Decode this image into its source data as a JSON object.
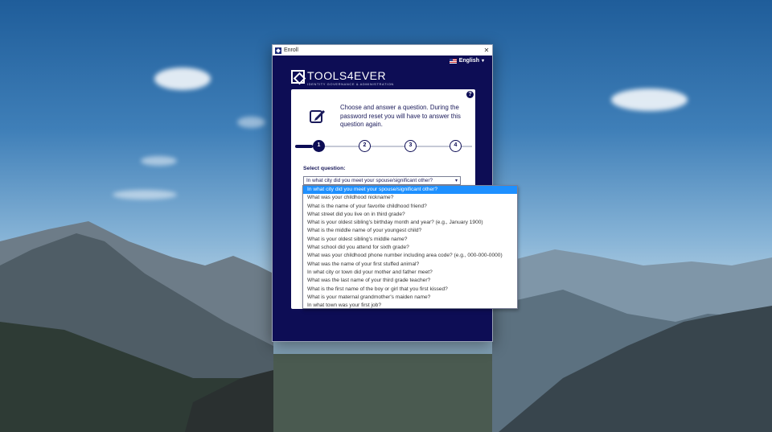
{
  "window": {
    "title": "Enroll",
    "close_glyph": "✕",
    "language": "English",
    "language_caret": "▾",
    "logo_text": "TOOLS4EVER",
    "logo_subtitle": "IDENTITY GOVERNANCE & ADMINISTRATION"
  },
  "card": {
    "help_glyph": "?",
    "intro": "Choose and answer a question. During the password reset you will have to answer this question again.",
    "steps": [
      "1",
      "2",
      "3",
      "4"
    ],
    "active_step": 1,
    "select_label": "Select question:",
    "selected_value": "In what city did you meet your spouse/significant other?",
    "select_arrow": "▾"
  },
  "dropdown": {
    "options": [
      "In what city did you meet your spouse/significant other?",
      "What was your childhood nickname?",
      "What is the name of your favorite childhood friend?",
      "What street did you live on in third grade?",
      "What is your oldest sibling's birthday month and year? (e.g., January 1900)",
      "What is the middle name of your youngest child?",
      "What is your oldest sibling's middle name?",
      "What school did you attend for sixth grade?",
      "What was your childhood phone number including area code? (e.g., 000-000-0000)",
      "What was the name of your first stuffed animal?",
      "In what city or town did your mother and father meet?",
      "What was the last name of your third grade teacher?",
      "What is the first name of the boy or girl that you first kissed?",
      "What is your maternal grandmother's maiden name?",
      "In what town was your first job?"
    ],
    "selected_index": 0
  },
  "colors": {
    "window_bg": "#0d0d55",
    "selection": "#1e90ff"
  },
  "icons": [
    "app-icon",
    "us-flag-icon",
    "logo-icon",
    "help-icon",
    "edit-icon"
  ]
}
